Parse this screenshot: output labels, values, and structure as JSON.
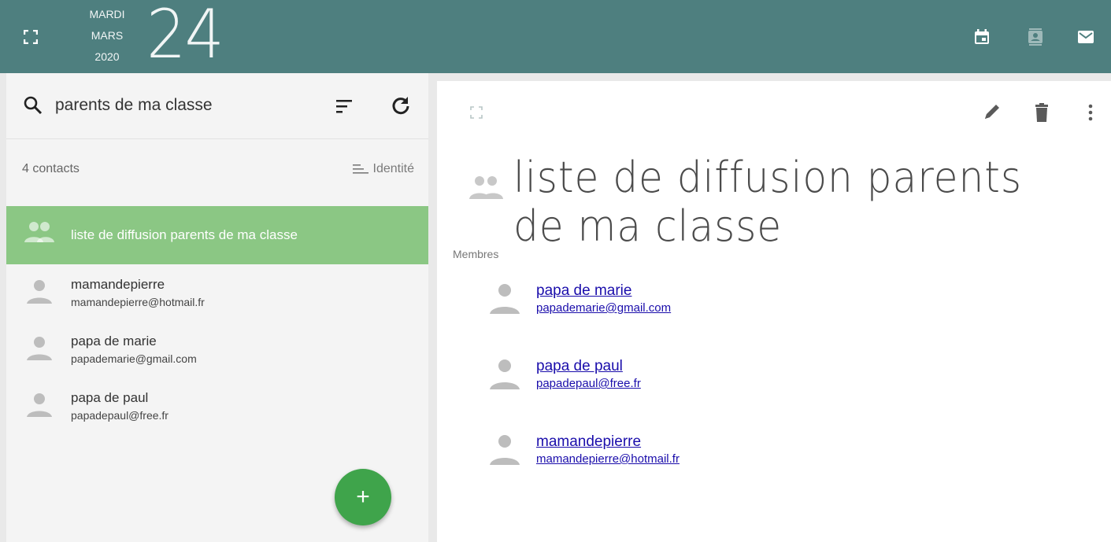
{
  "header": {
    "weekday": "MARDI",
    "month": "MARS",
    "year": "2020",
    "day": "24",
    "background_color": "#4e7f7f"
  },
  "search": {
    "value": "parents de ma classe",
    "placeholder": ""
  },
  "list_header": {
    "count_label": "4 contacts",
    "sort_label": "Identité"
  },
  "contacts": [
    {
      "name": "liste de diffusion parents de ma classe",
      "email": "",
      "type": "group",
      "selected": true
    },
    {
      "name": "mamandepierre",
      "email": "mamandepierre@hotmail.fr",
      "type": "person",
      "selected": false
    },
    {
      "name": "papa de marie",
      "email": "papademarie@gmail.com",
      "type": "person",
      "selected": false
    },
    {
      "name": "papa de paul",
      "email": "papadepaul@free.fr",
      "type": "person",
      "selected": false
    }
  ],
  "add_button": {
    "label": "+",
    "color": "#3fa44b"
  },
  "detail": {
    "title": "liste de diffusion parents de ma classe",
    "members_label": "Membres",
    "members": [
      {
        "name": "papa de marie",
        "email": "papademarie@gmail.com"
      },
      {
        "name": "papa de paul",
        "email": "papadepaul@free.fr"
      },
      {
        "name": "mamandepierre",
        "email": "mamandepierre@hotmail.fr"
      }
    ]
  },
  "colors": {
    "selected_row": "#8bc784",
    "link": "#1a0dab"
  },
  "icons": {
    "header": [
      "fullscreen-icon",
      "calendar-icon",
      "contacts-icon",
      "mail-icon"
    ],
    "search_bar": [
      "search-icon",
      "sort-icon",
      "refresh-icon"
    ],
    "detail_toolbar": [
      "fullscreen-icon",
      "edit-icon",
      "delete-icon",
      "more-vert-icon"
    ]
  }
}
